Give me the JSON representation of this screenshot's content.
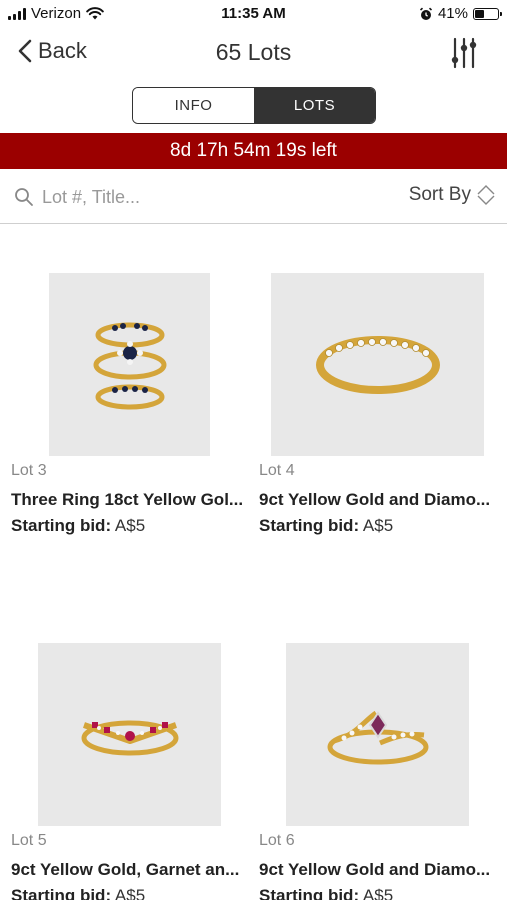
{
  "status_bar": {
    "carrier": "Verizon",
    "time": "11:35 AM",
    "battery": "41%",
    "battery_level": 0.41
  },
  "nav": {
    "back_label": "Back",
    "title": "65 Lots"
  },
  "tabs": [
    {
      "label": "INFO",
      "active": false
    },
    {
      "label": "LOTS",
      "active": true
    }
  ],
  "countdown": "8d 17h 54m 19s left",
  "search": {
    "placeholder": "Lot #, Title...",
    "value": ""
  },
  "sort_label": "Sort By",
  "lots": [
    {
      "lot": "Lot 3",
      "title": "Three Ring 18ct Yellow Gol...",
      "bid_label": "Starting bid:",
      "bid_value": "A$5"
    },
    {
      "lot": "Lot 4",
      "title": "9ct Yellow Gold and Diamo...",
      "bid_label": "Starting bid:",
      "bid_value": "A$5"
    },
    {
      "lot": "Lot 5",
      "title": "9ct Yellow Gold, Garnet an...",
      "bid_label": "Starting bid:",
      "bid_value": "A$5"
    },
    {
      "lot": "Lot 6",
      "title": "9ct Yellow Gold and Diamo...",
      "bid_label": "Starting bid:",
      "bid_value": "A$5"
    }
  ],
  "colors": {
    "countdown_bg": "#9b0000",
    "segment_active": "#333333"
  }
}
